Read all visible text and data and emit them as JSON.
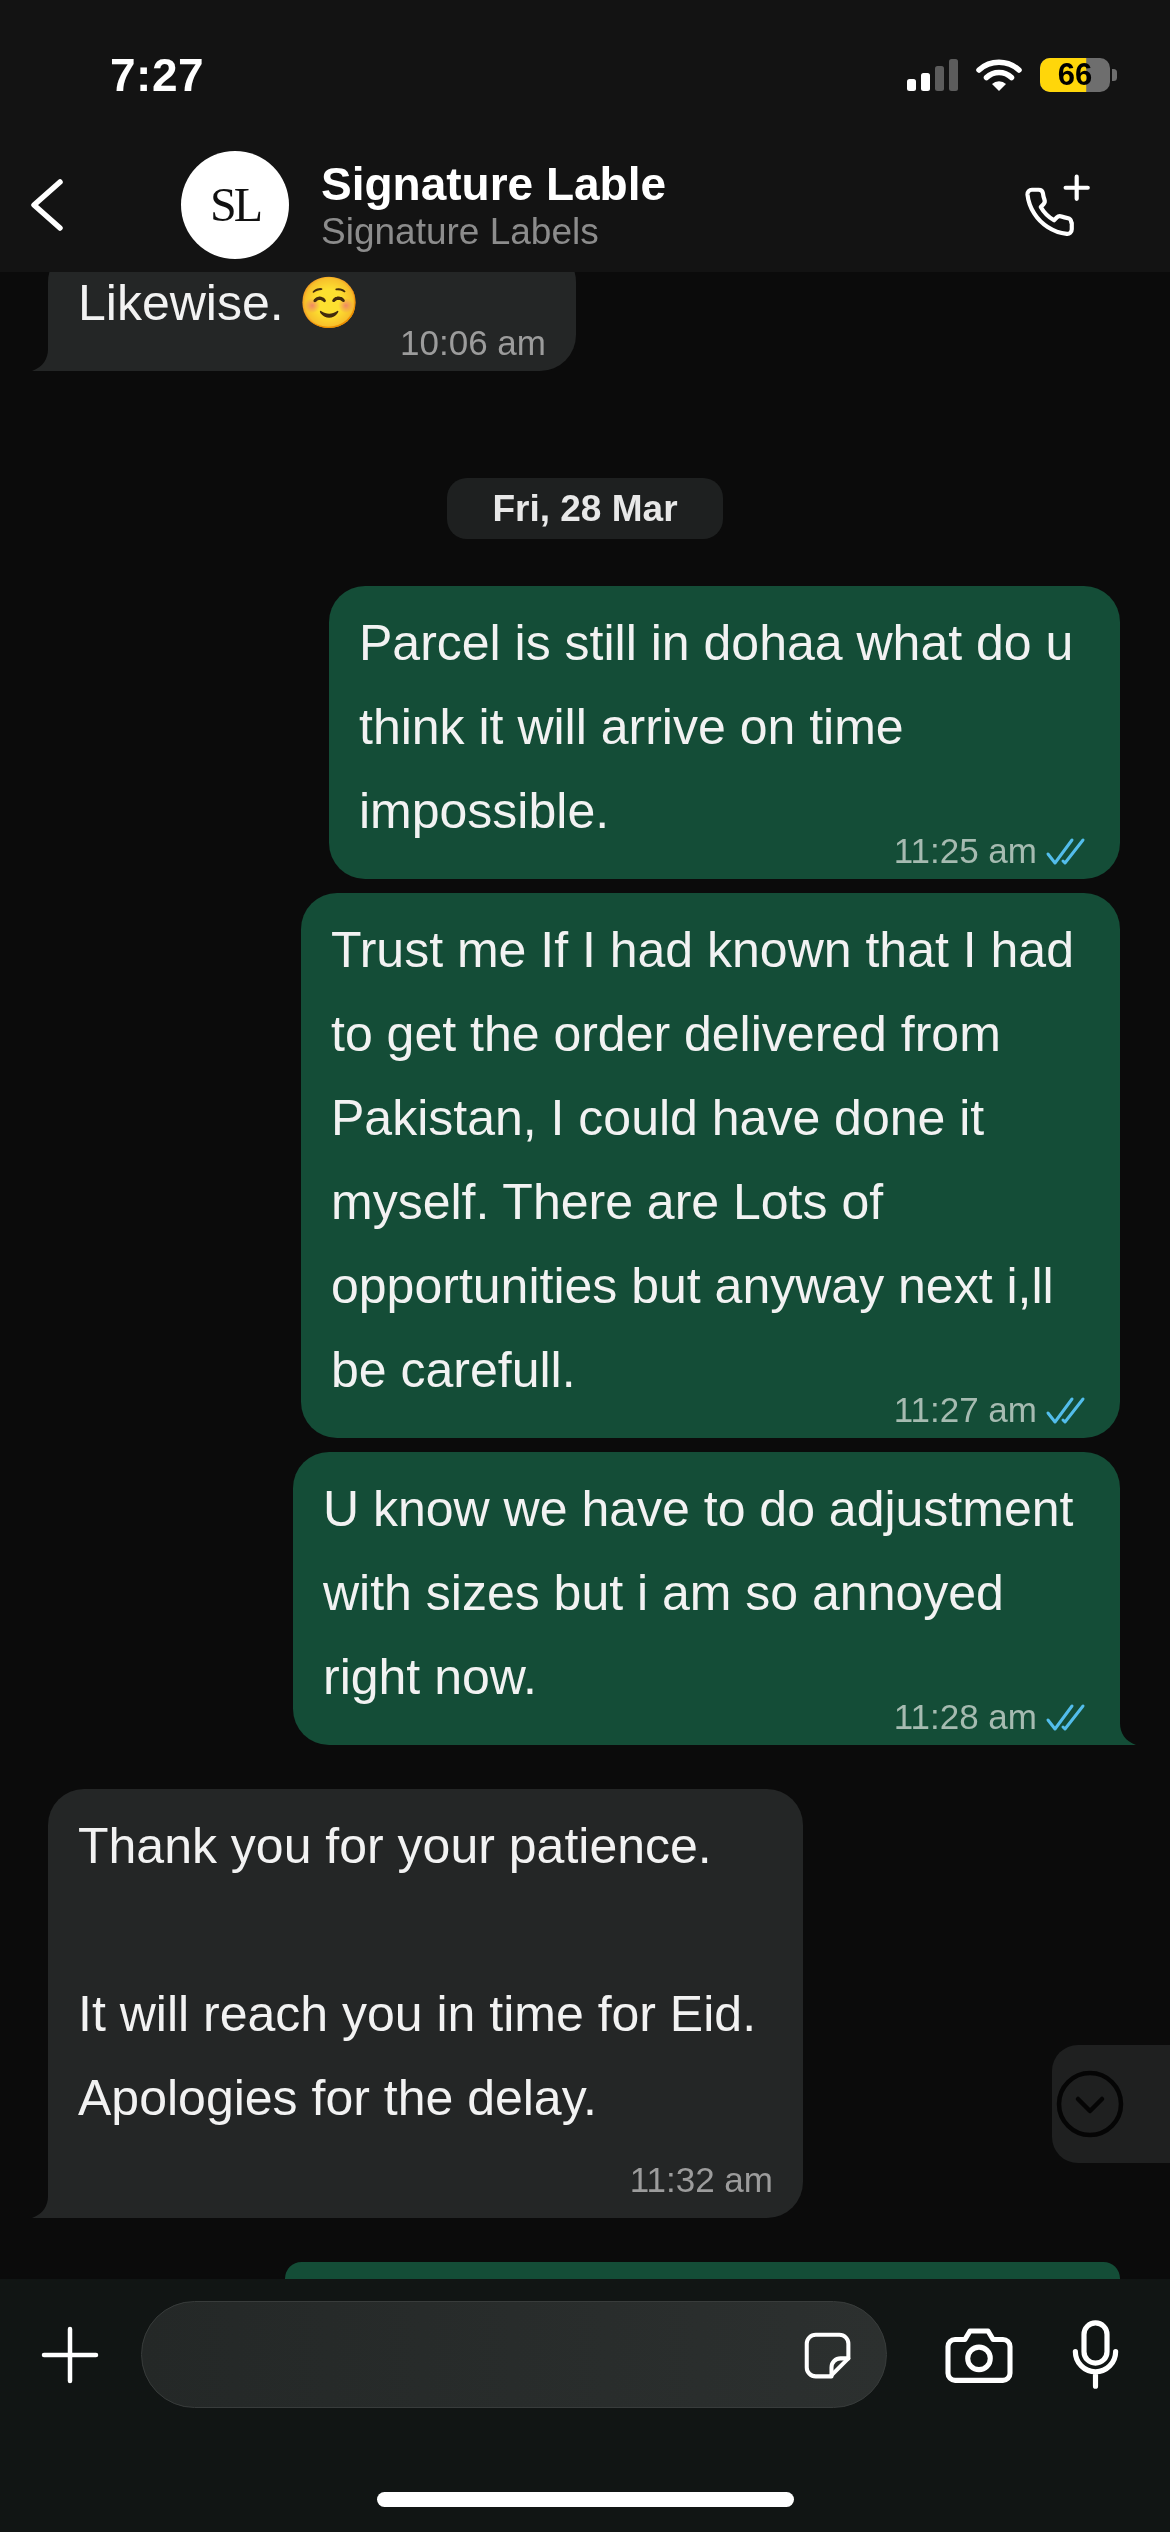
{
  "status_bar": {
    "time": "7:27",
    "battery": "66",
    "low_power_mode": true
  },
  "header": {
    "avatar_text": "SL",
    "title": "Signature Lable",
    "subtitle": "Signature Labels"
  },
  "messages": [
    {
      "kind": "incoming",
      "text": "Likewise. ☺️",
      "time": "10:06 am"
    },
    {
      "kind": "date",
      "text": "Fri, 28 Mar"
    },
    {
      "kind": "outgoing",
      "text": "Parcel is still in dohaa what do u think it will arrive on time impossible.",
      "time": "11:25 am",
      "read": true
    },
    {
      "kind": "outgoing",
      "text": "Trust me If I had known that I had to get the order delivered from Pakistan, I could have done it myself. There are Lots of opportunities but anyway next i,ll be carefull.",
      "time": "11:27 am",
      "read": true
    },
    {
      "kind": "outgoing",
      "text": "U know we have to do adjustment with sizes but i am so annoyed right now.",
      "time": "11:28 am",
      "read": true
    },
    {
      "kind": "incoming",
      "text": "Thank you for your patience.\n\nIt will reach you in time for Eid. Apologies for the delay.",
      "time": "11:32 am"
    },
    {
      "kind": "outgoing"
    }
  ]
}
